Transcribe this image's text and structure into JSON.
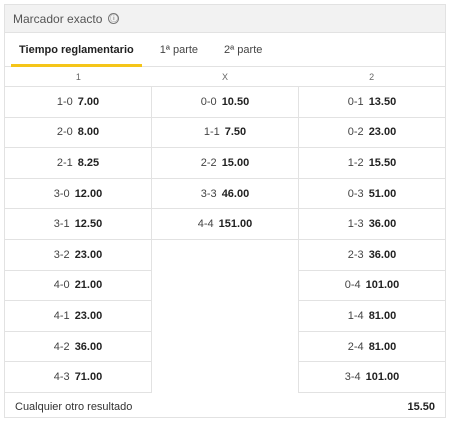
{
  "header": {
    "title": "Marcador exacto",
    "info_icon": "ⓘ"
  },
  "tabs": [
    {
      "label": "Tiempo reglamentario",
      "active": true
    },
    {
      "label": "1ª parte",
      "active": false
    },
    {
      "label": "2ª parte",
      "active": false
    }
  ],
  "columns": [
    "1",
    "X",
    "2"
  ],
  "home": [
    {
      "score": "1-0",
      "odd": "7.00"
    },
    {
      "score": "2-0",
      "odd": "8.00"
    },
    {
      "score": "2-1",
      "odd": "8.25"
    },
    {
      "score": "3-0",
      "odd": "12.00"
    },
    {
      "score": "3-1",
      "odd": "12.50"
    },
    {
      "score": "3-2",
      "odd": "23.00"
    },
    {
      "score": "4-0",
      "odd": "21.00"
    },
    {
      "score": "4-1",
      "odd": "23.00"
    },
    {
      "score": "4-2",
      "odd": "36.00"
    },
    {
      "score": "4-3",
      "odd": "71.00"
    }
  ],
  "draw": [
    {
      "score": "0-0",
      "odd": "10.50"
    },
    {
      "score": "1-1",
      "odd": "7.50"
    },
    {
      "score": "2-2",
      "odd": "15.00"
    },
    {
      "score": "3-3",
      "odd": "46.00"
    },
    {
      "score": "4-4",
      "odd": "151.00"
    }
  ],
  "away": [
    {
      "score": "0-1",
      "odd": "13.50"
    },
    {
      "score": "0-2",
      "odd": "23.00"
    },
    {
      "score": "1-2",
      "odd": "15.50"
    },
    {
      "score": "0-3",
      "odd": "51.00"
    },
    {
      "score": "1-3",
      "odd": "36.00"
    },
    {
      "score": "2-3",
      "odd": "36.00"
    },
    {
      "score": "0-4",
      "odd": "101.00"
    },
    {
      "score": "1-4",
      "odd": "81.00"
    },
    {
      "score": "2-4",
      "odd": "81.00"
    },
    {
      "score": "3-4",
      "odd": "101.00"
    }
  ],
  "other": {
    "label": "Cualquier otro resultado",
    "odd": "15.50"
  },
  "colors": {
    "accent": "#f5c518",
    "header_bg": "#f2f2f2",
    "border": "#e2e2e2"
  }
}
